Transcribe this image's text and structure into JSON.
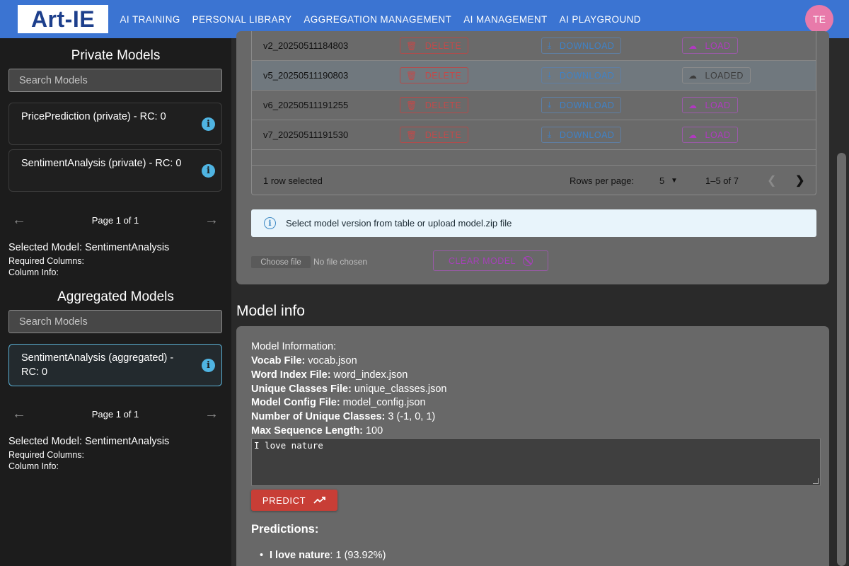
{
  "app": {
    "logo": "Art-IE",
    "nav": [
      "AI TRAINING",
      "PERSONAL LIBRARY",
      "AGGREGATION MANAGEMENT",
      "AI MANAGEMENT",
      "AI PLAYGROUND"
    ],
    "avatar": "TE",
    "colors": {
      "topbar": "#3b74d2",
      "avatar": "#e87aaa",
      "predict": "#c83e36"
    }
  },
  "private": {
    "title": "Private Models",
    "search_placeholder": "Search Models",
    "cards": [
      "PricePrediction (private) - RC: 0",
      "SentimentAnalysis (private) - RC: 0"
    ],
    "page": "Page 1 of 1",
    "selected": "Selected Model: SentimentAnalysis",
    "required": "Required Columns:",
    "column_info": "Column Info:"
  },
  "aggregated": {
    "title": "Aggregated Models",
    "search_placeholder": "Search Models",
    "cards": [
      "SentimentAnalysis (aggregated) - RC: 0"
    ],
    "page": "Page 1 of 1",
    "selected": "Selected Model: SentimentAnalysis",
    "required": "Required Columns:",
    "column_info": "Column Info:"
  },
  "versions": {
    "rows": [
      {
        "name": "v2_20250511184803",
        "load": "LOAD"
      },
      {
        "name": "v5_20250511190803",
        "load": "LOADED"
      },
      {
        "name": "v6_20250511191255",
        "load": "LOAD"
      },
      {
        "name": "v7_20250511191530",
        "load": "LOAD"
      }
    ],
    "delete_label": "DELETE",
    "download_label": "DOWNLOAD",
    "footer": {
      "selected": "1 row selected",
      "rows_per_page_label": "Rows per page:",
      "rows_per_page": "5",
      "range": "1–5 of 7"
    }
  },
  "alert": "Select model version from table or upload model.zip file",
  "upload": {
    "button": "Choose file",
    "status": "No file chosen",
    "clear": "CLEAR MODEL"
  },
  "model_info": {
    "section_title": "Model info",
    "heading": "Model Information:",
    "fields": [
      {
        "label": "Vocab File:",
        "value": " vocab.json"
      },
      {
        "label": "Word Index File:",
        "value": " word_index.json"
      },
      {
        "label": "Unique Classes File:",
        "value": " unique_classes.json"
      },
      {
        "label": "Model Config File:",
        "value": " model_config.json"
      },
      {
        "label": "Number of Unique Classes:",
        "value": " 3 (-1, 0, 1)"
      },
      {
        "label": "Max Sequence Length:",
        "value": " 100"
      }
    ],
    "input_text": "I love nature",
    "predict_label": "PREDICT",
    "predictions_title": "Predictions:",
    "predictions": [
      {
        "text": "I love nature",
        "result": ": 1 (93.92%)"
      }
    ]
  }
}
